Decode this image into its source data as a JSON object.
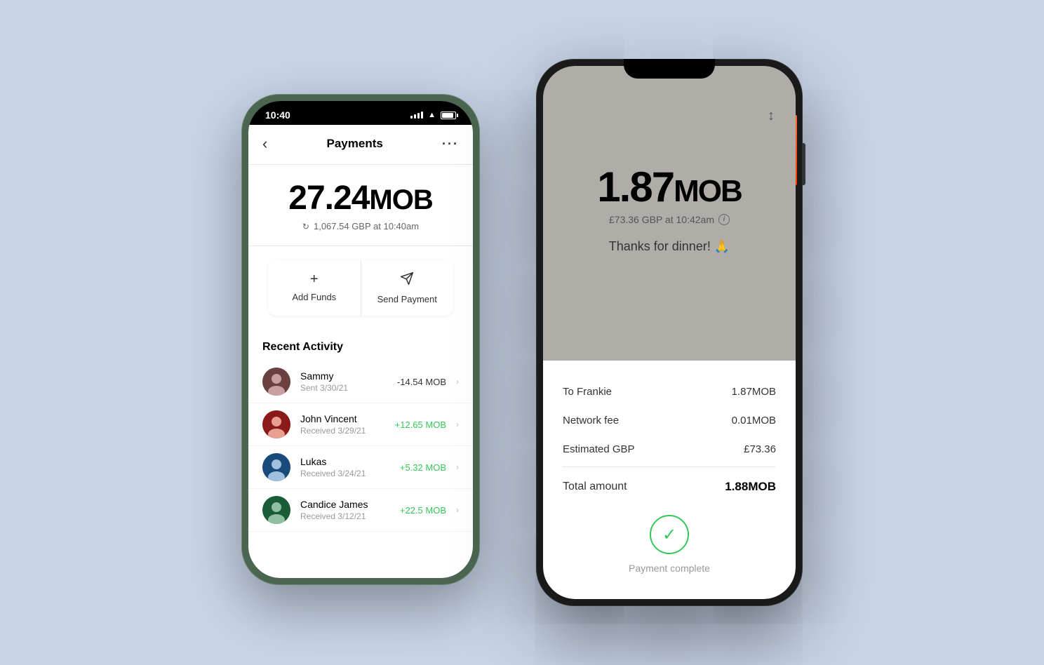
{
  "background_color": "#c8d4e8",
  "phone1": {
    "status_bar": {
      "time": "10:40",
      "signal": "signal",
      "wifi": "wifi",
      "battery": "battery"
    },
    "header": {
      "back_label": "‹",
      "title": "Payments",
      "more_label": "···"
    },
    "balance": {
      "amount": "27.24",
      "unit": "MOB",
      "fiat_prefix": "1,067.54 GBP at 10:40am"
    },
    "actions": [
      {
        "icon": "+",
        "label": "Add Funds"
      },
      {
        "icon": "send",
        "label": "Send Payment"
      }
    ],
    "recent_activity_title": "Recent Activity",
    "activity_items": [
      {
        "name": "Sammy",
        "date": "Sent 3/30/21",
        "amount": "-14.54 MOB",
        "type": "negative"
      },
      {
        "name": "John Vincent",
        "date": "Received 3/29/21",
        "amount": "+12.65 MOB",
        "type": "positive"
      },
      {
        "name": "Lukas",
        "date": "Received 3/24/21",
        "amount": "+5.32 MOB",
        "type": "positive"
      },
      {
        "name": "Candice James",
        "date": "Received 3/12/21",
        "amount": "+22.5 MOB",
        "type": "positive"
      }
    ]
  },
  "phone2": {
    "amount": "1.87",
    "unit": "MOB",
    "fiat_rate": "£73.36 GBP at 10:42am",
    "note": "Thanks for dinner! 🙏",
    "payment_details": [
      {
        "label": "To Frankie",
        "value": "1.87MOB"
      },
      {
        "label": "Network fee",
        "value": "0.01MOB"
      },
      {
        "label": "Estimated GBP",
        "value": "£73.36"
      }
    ],
    "total_label": "Total amount",
    "total_value": "1.88MOB",
    "complete_text": "Payment complete"
  }
}
